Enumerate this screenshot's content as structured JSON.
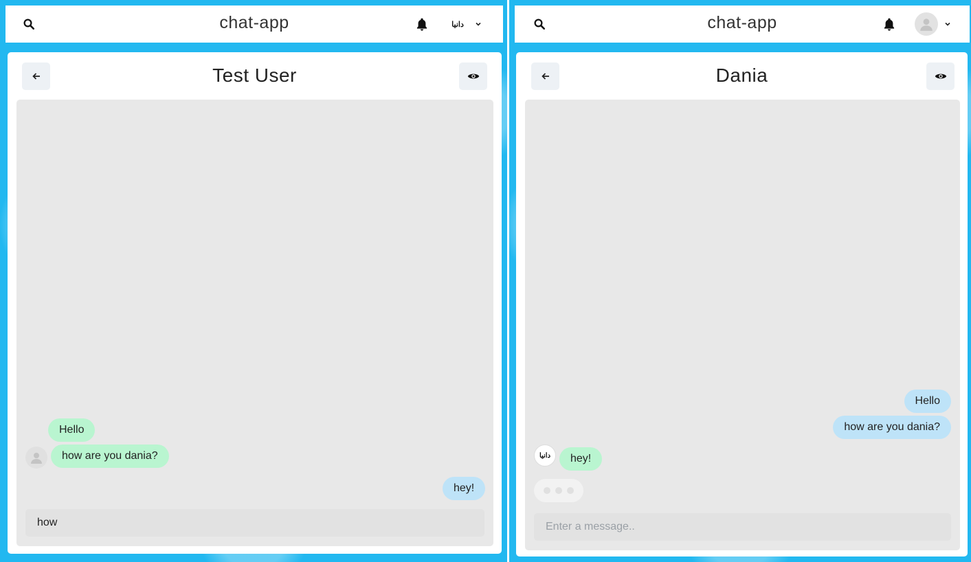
{
  "left": {
    "app_title": "chat-app",
    "profile_logo_text": "دانيا",
    "chat_title": "Test User",
    "messages": [
      {
        "text": "Hello",
        "side": "received"
      },
      {
        "text": "how are you dania?",
        "side": "received"
      },
      {
        "text": "hey!",
        "side": "sent"
      }
    ],
    "input_value": "how",
    "input_placeholder": "Enter a message.."
  },
  "right": {
    "app_title": "chat-app",
    "chat_title": "Dania",
    "sender_logo_text": "دانيا",
    "messages": [
      {
        "text": "Hello",
        "side": "sent"
      },
      {
        "text": "how are you dania?",
        "side": "sent"
      },
      {
        "text": "hey!",
        "side": "received"
      }
    ],
    "input_value": "",
    "input_placeholder": "Enter a message.."
  },
  "icons": {
    "search": "search-icon",
    "bell": "bell-icon",
    "chevron": "chevron-down-icon",
    "back": "arrow-left-icon",
    "eye": "eye-icon",
    "user": "user-icon"
  },
  "colors": {
    "background": "#22b8f0",
    "received_bubble": "#b9f5d0",
    "sent_bubble": "#bee3f8",
    "chat_area": "#e8e8e8"
  }
}
